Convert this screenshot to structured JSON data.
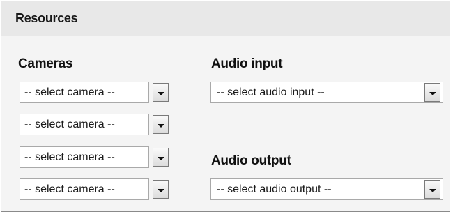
{
  "panel": {
    "title": "Resources"
  },
  "cameras": {
    "label": "Cameras",
    "selects": [
      "-- select camera --",
      "-- select camera --",
      "-- select camera --",
      "-- select camera --"
    ]
  },
  "audio_input": {
    "label": "Audio input",
    "select": "-- select audio input --"
  },
  "audio_output": {
    "label": "Audio output",
    "select": "-- select audio output --"
  },
  "icons": {
    "dropdown": "chevron-down-icon"
  }
}
